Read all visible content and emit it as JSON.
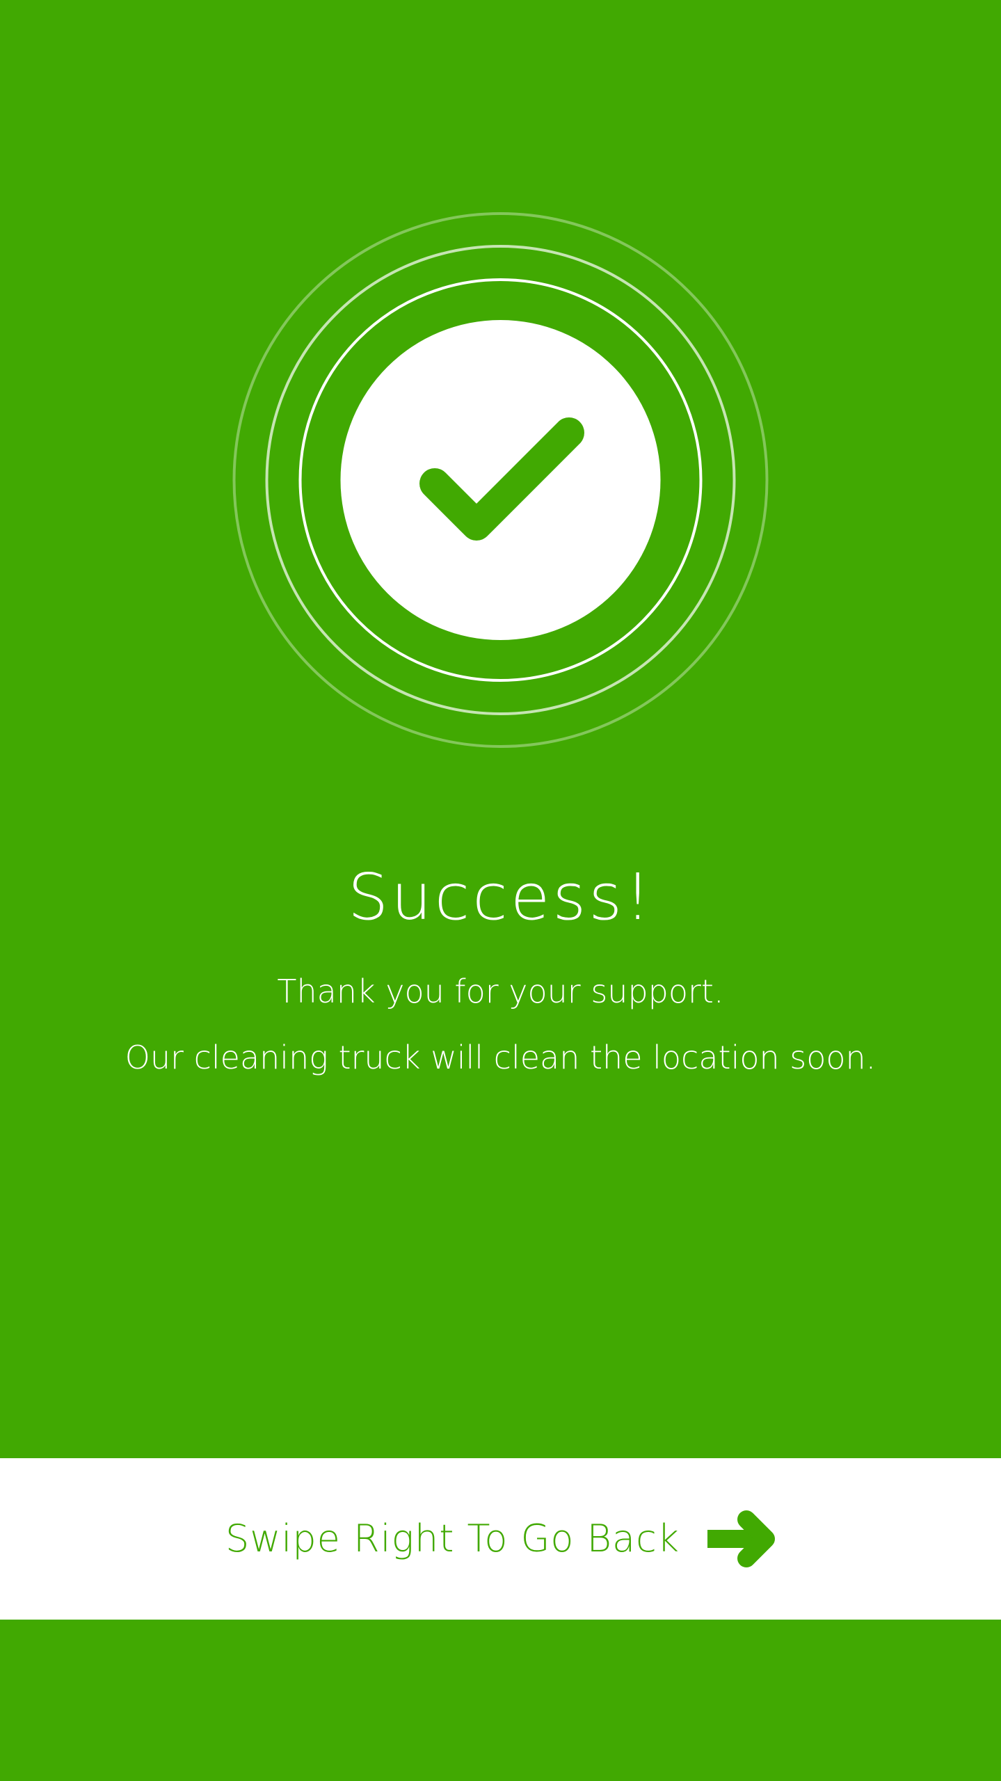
{
  "colors": {
    "background": "#41a902",
    "bar_background": "#ffffff",
    "text_on_green": "#ffffff",
    "accent": "#41a902"
  },
  "hero": {
    "icon": "check-circle-icon"
  },
  "content": {
    "title": "Success!",
    "message_line_1": "Thank you for your support.",
    "message_line_2": "Our cleaning truck will clean the location soon."
  },
  "swipe_bar": {
    "label": "Swipe Right To Go Back",
    "icon": "arrow-right-icon"
  }
}
